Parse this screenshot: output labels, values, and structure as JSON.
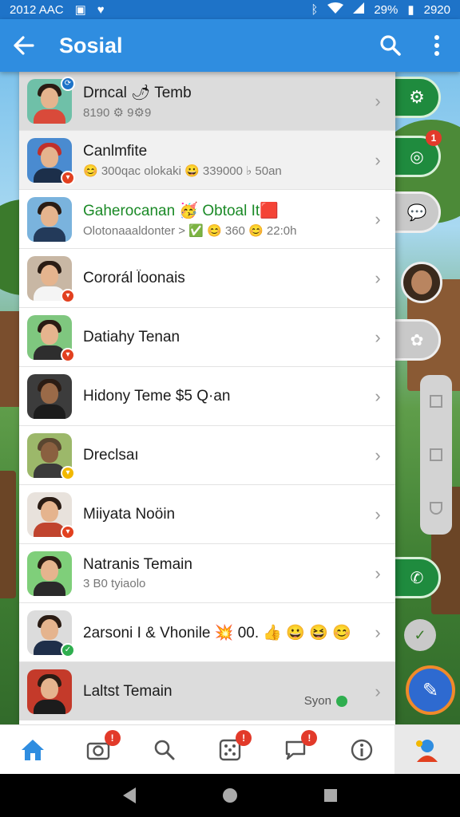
{
  "status_bar": {
    "time_left": "2012 AAC",
    "battery": "29%",
    "time_right": "2920"
  },
  "app_bar": {
    "title": "Sosial"
  },
  "contacts": [
    {
      "name": "Drncal 🌶 Temb",
      "subtitle": "8190 ⚙ 9⚙9",
      "badge_color": "#1e73c8",
      "status": ""
    },
    {
      "name": "Canlmfite",
      "subtitle": "😊 300qac olokaki 😀 339000 ♭ 50an",
      "badge_color": "#e2401f",
      "status": ""
    },
    {
      "name": "Gaherocanan 🥳 Obtoal It🟥",
      "subtitle": "Olotonaaaldonter > ✅ 😊 360 😊 22:0h",
      "badge_color": "",
      "status": ""
    },
    {
      "name": "Cororál l̈oonais",
      "subtitle": "",
      "badge_color": "#e2401f",
      "status": ""
    },
    {
      "name": "Datiahy Tenan",
      "subtitle": "",
      "badge_color": "#e2401f",
      "status": ""
    },
    {
      "name": "Hidony Teme $5 Q·an",
      "subtitle": "",
      "badge_color": "",
      "status": ""
    },
    {
      "name": "Dreclsaı",
      "subtitle": "",
      "badge_color": "#f2b800",
      "status": ""
    },
    {
      "name": "Miiyata Noöin",
      "subtitle": "",
      "badge_color": "#e2401f",
      "status": ""
    },
    {
      "name": "Natranis Temain",
      "subtitle": "3 B0 tyiaolo",
      "badge_color": "",
      "status": ""
    },
    {
      "name": "2arsoni I & Vhonile 💥 00. 👍 😀 😆 😊",
      "subtitle": "",
      "badge_color": "#2fae4f",
      "status": ""
    },
    {
      "name": "Laltst Temain",
      "subtitle": "",
      "badge_color": "",
      "status": "Syon"
    }
  ],
  "side_badges": {
    "compass": "1"
  },
  "bottom_nav": {
    "home": {
      "badge": ""
    },
    "camera": {
      "badge": "!"
    },
    "search": {
      "badge": ""
    },
    "grid": {
      "badge": "!"
    },
    "chat": {
      "badge": "!"
    },
    "info": {
      "badge": ""
    }
  },
  "colors": {
    "app_bar": "#2f8de0",
    "accent_green": "#1b8a27",
    "badge_red": "#e23a2a"
  }
}
